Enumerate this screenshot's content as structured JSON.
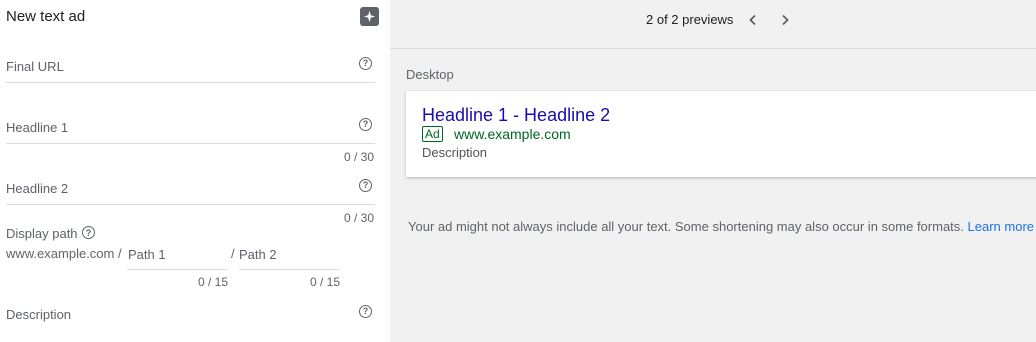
{
  "form": {
    "title": "New text ad",
    "sparkle_icon": "sparkle-icon",
    "final_url": {
      "label": "Final URL"
    },
    "headline1": {
      "label": "Headline 1",
      "counter": "0 / 30"
    },
    "headline2": {
      "label": "Headline 2",
      "counter": "0 / 30"
    },
    "display_path": {
      "label": "Display path",
      "base_url": "www.example.com",
      "sep1": "/",
      "path1_placeholder": "Path 1",
      "path1_counter": "0 / 15",
      "sep2": "/",
      "path2_placeholder": "Path 2",
      "path2_counter": "0 / 15"
    },
    "description": {
      "label": "Description"
    },
    "help_glyph": "?"
  },
  "preview": {
    "count": "2 of 2 previews",
    "device_label": "Desktop",
    "ad": {
      "headline": "Headline 1 - Headline 2",
      "badge": "Ad",
      "url": "www.example.com",
      "description": "Description"
    },
    "disclaimer": "Your ad might not always include all your text. Some shortening may also occur in some formats.",
    "learn_more": "Learn more"
  },
  "colors": {
    "headline_link": "#1a0dab",
    "url_green": "#006621",
    "link_blue": "#1a73e8",
    "preview_bg": "#f1f1f1"
  }
}
